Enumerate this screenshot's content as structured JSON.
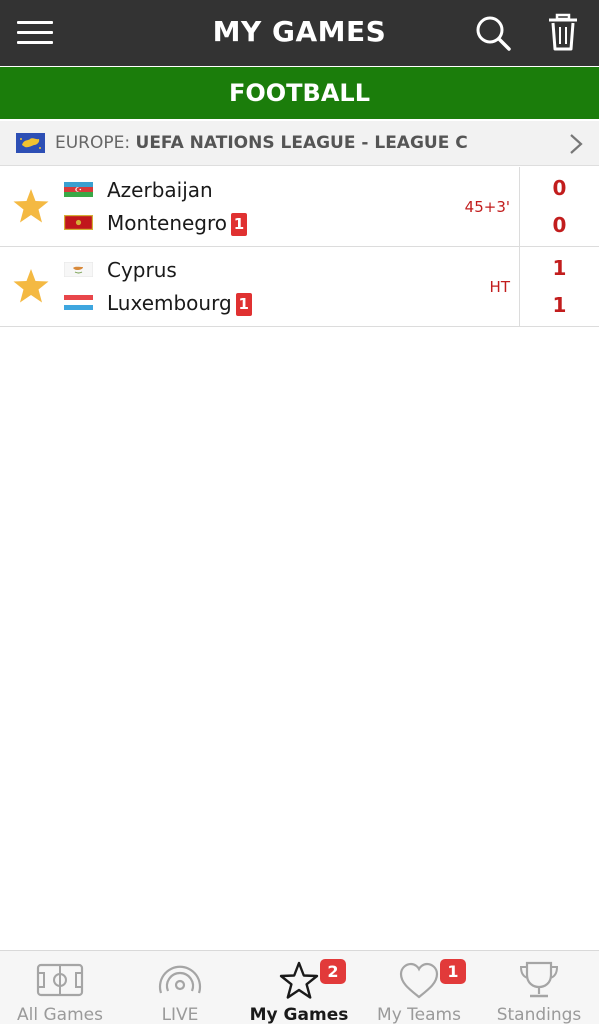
{
  "header": {
    "title": "MY GAMES",
    "menu_icon": "hamburger-menu-icon",
    "search_icon": "search-icon",
    "trash_icon": "trash-icon",
    "background_color": "#333333"
  },
  "sport": {
    "label": "FOOTBALL",
    "color": "#1b7d0b"
  },
  "league": {
    "region": "EUROPE:",
    "name": "UEFA NATIONS LEAGUE - LEAGUE C",
    "flag_icon": "europe-flag-icon",
    "chevron_icon": "chevron-right-icon"
  },
  "matches": [
    {
      "favorite_icon": "star-icon",
      "home": {
        "name": "Azerbaijan",
        "flag_icon": "azerbaijan-flag-icon",
        "red_cards": null
      },
      "away": {
        "name": "Montenegro",
        "flag_icon": "montenegro-flag-icon",
        "red_cards": "1"
      },
      "status": "45+3'",
      "home_score": "0",
      "away_score": "0"
    },
    {
      "favorite_icon": "star-icon",
      "home": {
        "name": "Cyprus",
        "flag_icon": "cyprus-flag-icon",
        "red_cards": null
      },
      "away": {
        "name": "Luxembourg",
        "flag_icon": "luxembourg-flag-icon",
        "red_cards": "1"
      },
      "status": "HT",
      "home_score": "1",
      "away_score": "1"
    }
  ],
  "bottom_nav": {
    "tabs": [
      {
        "label": "All Games",
        "icon": "football-pitch-icon",
        "active": false,
        "badge": null
      },
      {
        "label": "LIVE",
        "icon": "live-broadcast-icon",
        "active": false,
        "badge": null
      },
      {
        "label": "My Games",
        "icon": "star-outline-icon",
        "active": true,
        "badge": "2"
      },
      {
        "label": "My Teams",
        "icon": "heart-outline-icon",
        "active": false,
        "badge": "1"
      },
      {
        "label": "Standings",
        "icon": "trophy-icon",
        "active": false,
        "badge": null
      }
    ]
  },
  "colors": {
    "score_red": "#c21d1d",
    "star_gold": "#f4b942",
    "badge_red": "#e23a3a"
  }
}
